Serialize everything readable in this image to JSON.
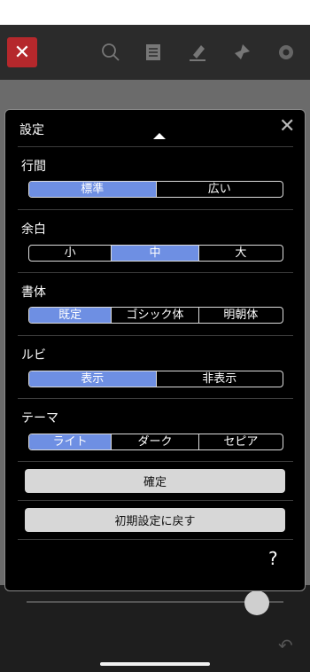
{
  "toolbar": {
    "close_glyph": "✕",
    "icons": [
      "search-icon",
      "list-icon",
      "pen-icon",
      "bookmark-pin-icon",
      "gear-icon"
    ]
  },
  "settings": {
    "title": "設定",
    "close_glyph": "✕",
    "sections": [
      {
        "label": "行間",
        "options": [
          "標準",
          "広い"
        ],
        "selected": 0
      },
      {
        "label": "余白",
        "options": [
          "小",
          "中",
          "大"
        ],
        "selected": 1
      },
      {
        "label": "書体",
        "options": [
          "既定",
          "ゴシック体",
          "明朝体"
        ],
        "selected": 0
      },
      {
        "label": "ルビ",
        "options": [
          "表示",
          "非表示"
        ],
        "selected": 0
      },
      {
        "label": "テーマ",
        "options": [
          "ライト",
          "ダーク",
          "セピア"
        ],
        "selected": 0
      }
    ],
    "confirm_label": "確定",
    "reset_label": "初期設定に戻す",
    "help_label": "?"
  },
  "colors": {
    "accent": "#6e8fe3",
    "close_bg": "#b5282c"
  }
}
